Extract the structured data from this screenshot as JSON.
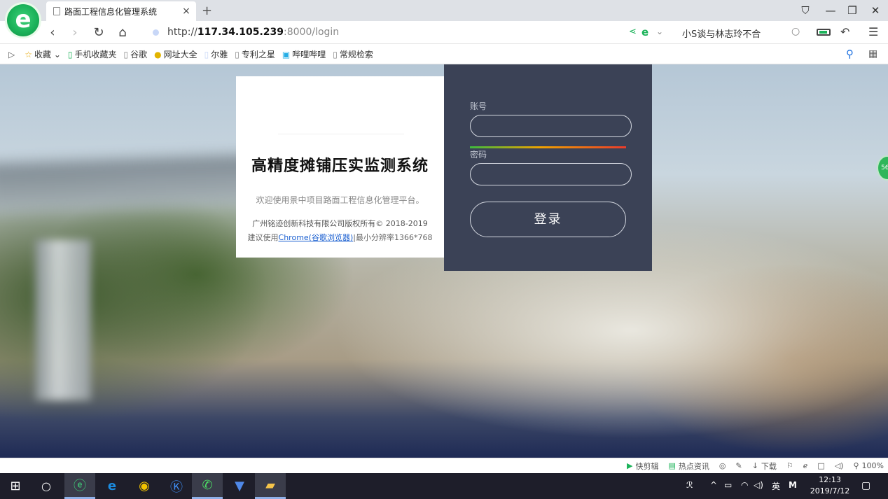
{
  "browser": {
    "tab_title": "路面工程信息化管理系统",
    "url_scheme": "http://",
    "url_host": "117.34.105.239",
    "url_rest": ":8000/login",
    "search_text": "小S谈与林志玲不合",
    "logo_glyph": "e"
  },
  "bookmarks": [
    {
      "icon": "☆",
      "label": "收藏 ⌄"
    },
    {
      "icon": "▯",
      "label": "手机收藏夹"
    },
    {
      "icon": "▯",
      "label": "谷歌"
    },
    {
      "icon": "●",
      "label": "网址大全"
    },
    {
      "icon": "▯",
      "label": "尔雅"
    },
    {
      "icon": "▯",
      "label": "专利之星"
    },
    {
      "icon": "▣",
      "label": "哔哩哔哩"
    },
    {
      "icon": "▯",
      "label": "常规检索"
    }
  ],
  "login": {
    "system_title": "高精度摊铺压实监测系统",
    "welcome": "欢迎使用景中项目路面工程信息化管理平台。",
    "copyright": "广州铭迹创新科技有限公司版权所有© 2018-2019",
    "suggest_prefix": "建议使用",
    "suggest_link": "Chrome(谷歌浏览器)",
    "suggest_suffix": "|最小分辨率1366*768",
    "account_label": "账号",
    "password_label": "密码",
    "login_button": "登录"
  },
  "badge": "56",
  "statusbar": {
    "items": [
      "快剪辑",
      "热点资讯",
      "下载"
    ],
    "zoom": "100%"
  },
  "taskbar": {
    "ime": "英",
    "time": "12:13",
    "date": "2019/7/12"
  }
}
